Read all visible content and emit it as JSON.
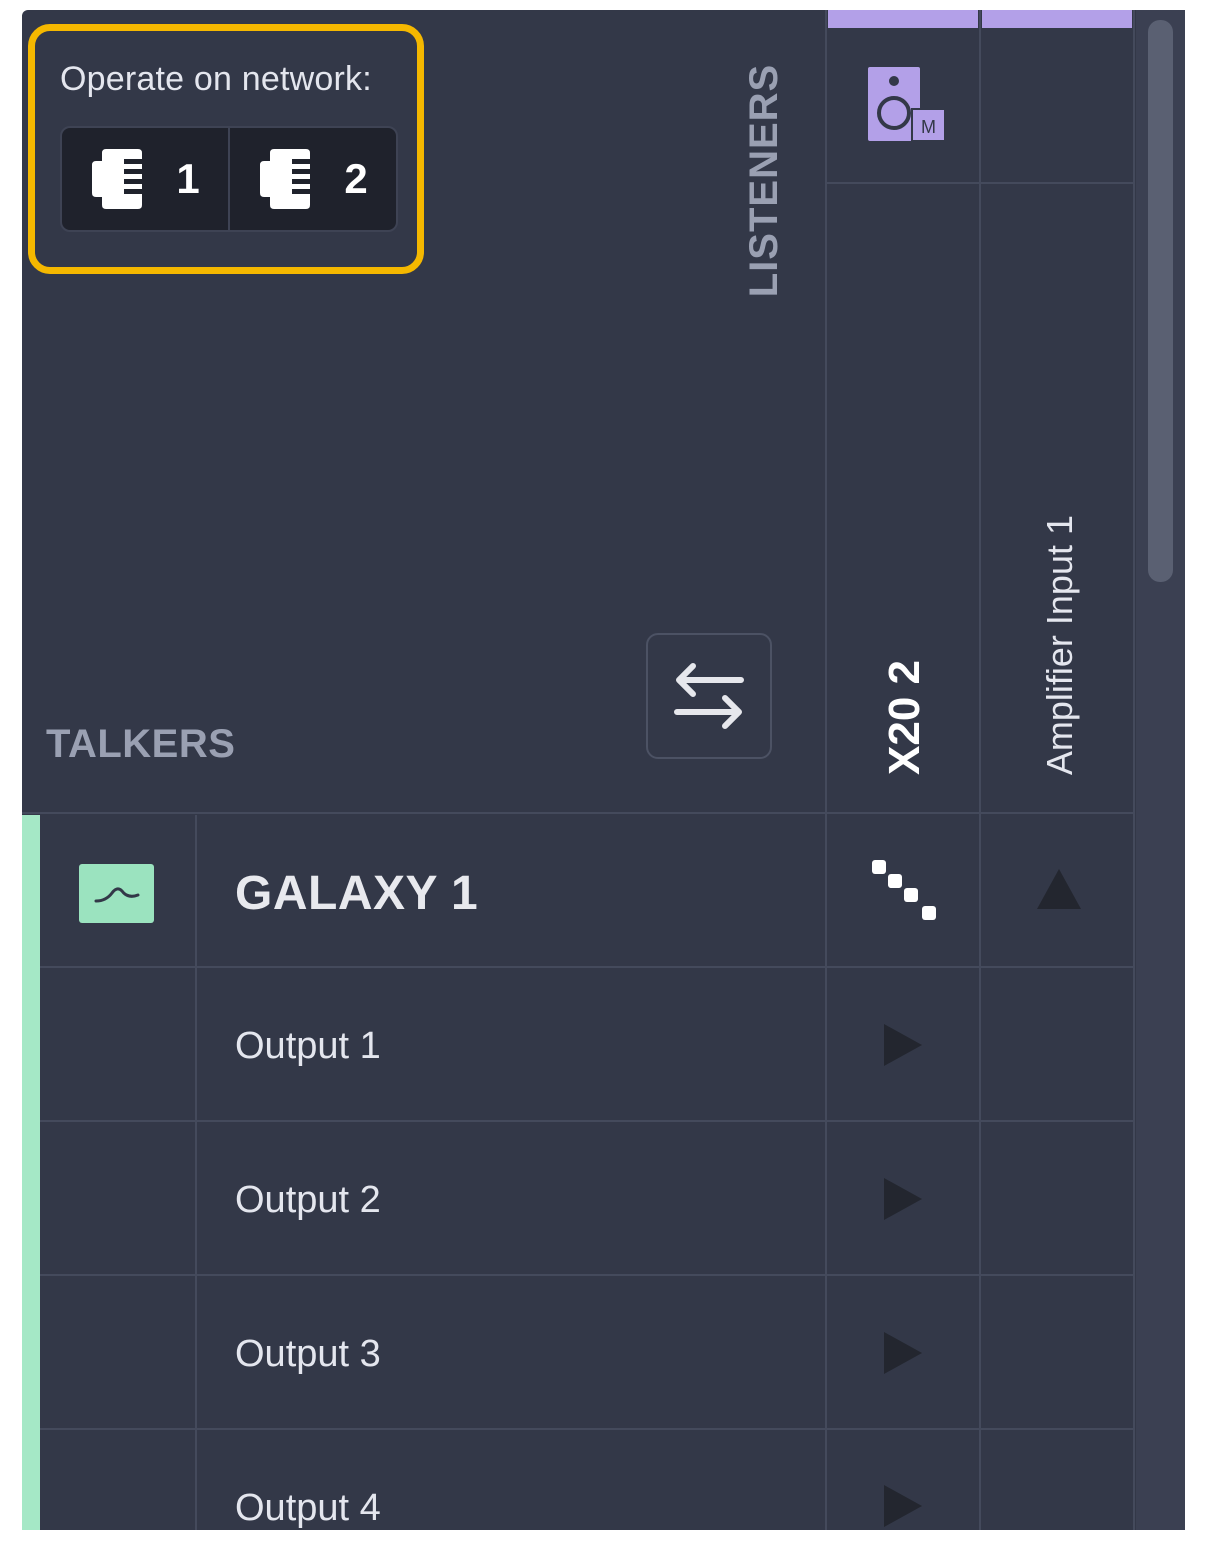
{
  "network": {
    "label": "Operate on network:",
    "buttons": [
      {
        "label": "1",
        "icon": "ethernet-port-icon"
      },
      {
        "label": "2",
        "icon": "ethernet-port-icon"
      }
    ]
  },
  "matrix": {
    "listeners_label": "LISTENERS",
    "talkers_label": "TALKERS",
    "swap_icon": "swap-arrows-icon",
    "columns": [
      {
        "label": "X20 2",
        "icon": "speaker-m-icon"
      },
      {
        "label": "Amplifier Input 1"
      }
    ],
    "talker": {
      "name": "GALAXY 1",
      "status_icon": "signal-wave-icon"
    },
    "rows": [
      {
        "label": "Output 1"
      },
      {
        "label": "Output 2"
      },
      {
        "label": "Output 3"
      },
      {
        "label": "Output 4"
      }
    ]
  },
  "colors": {
    "panel_bg": "#333848",
    "highlight": "#f5b800",
    "talker_accent": "#a5e8c6",
    "listener_accent": "#b3a0e8"
  }
}
